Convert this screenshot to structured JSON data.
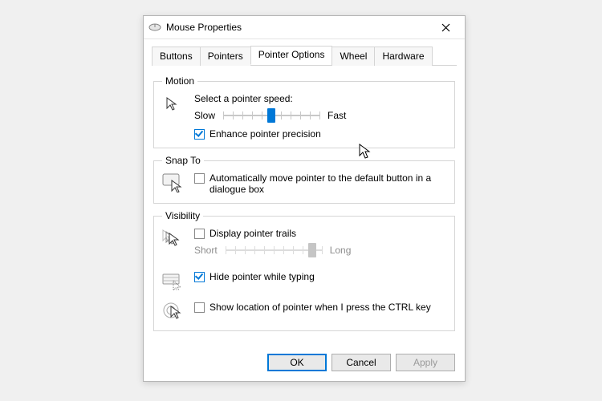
{
  "window": {
    "title": "Mouse Properties"
  },
  "tabs": {
    "buttons": "Buttons",
    "pointers": "Pointers",
    "pointer_options": "Pointer Options",
    "wheel": "Wheel",
    "hardware": "Hardware",
    "active": "pointer_options"
  },
  "motion": {
    "legend": "Motion",
    "select_label": "Select a pointer speed:",
    "slow": "Slow",
    "fast": "Fast",
    "speed_value": 5,
    "speed_max": 10,
    "enhance_label": "Enhance pointer precision",
    "enhance_checked": true
  },
  "snap": {
    "legend": "Snap To",
    "auto_label": "Automatically move pointer to the default button in a dialogue box",
    "auto_checked": false
  },
  "visibility": {
    "legend": "Visibility",
    "trails_label": "Display pointer trails",
    "trails_checked": false,
    "short": "Short",
    "long": "Long",
    "trails_value": 9,
    "trails_max": 10,
    "hide_label": "Hide pointer while typing",
    "hide_checked": true,
    "ctrl_label": "Show location of pointer when I press the CTRL key",
    "ctrl_checked": false
  },
  "buttons": {
    "ok": "OK",
    "cancel": "Cancel",
    "apply": "Apply"
  }
}
